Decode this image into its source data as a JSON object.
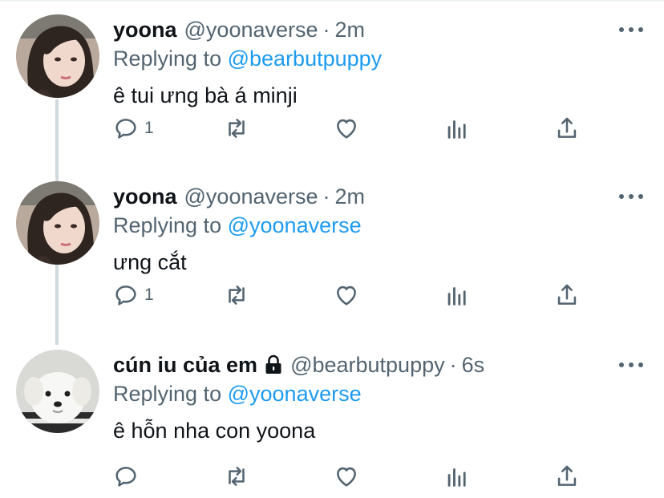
{
  "tweets": [
    {
      "name": "yoona",
      "handle": "@yoonaverse",
      "separator": "·",
      "time": "2m",
      "replying_prefix": "Replying to",
      "replying_to": "@bearbutpuppy",
      "text": "ê tui ưng bà á minji",
      "reply_count": "1",
      "avatar_icon": "girl-portrait-avatar",
      "protected": false
    },
    {
      "name": "yoona",
      "handle": "@yoonaverse",
      "separator": "·",
      "time": "2m",
      "replying_prefix": "Replying to",
      "replying_to": "@yoonaverse",
      "text": "ưng cắt",
      "reply_count": "1",
      "avatar_icon": "girl-portrait-avatar",
      "protected": false
    },
    {
      "name": "cún iu của em",
      "handle": "@bearbutpuppy",
      "separator": "·",
      "time": "6s",
      "replying_prefix": "Replying to",
      "replying_to": "@yoonaverse",
      "text": "ê hỗn nha con yoona",
      "reply_count": "",
      "avatar_icon": "white-puppy-avatar",
      "protected": true
    }
  ],
  "colors": {
    "text_primary": "#0f1419",
    "text_secondary": "#536471",
    "accent": "#1d9bf0",
    "thread_line": "#cfd9de"
  },
  "icons": [
    "reply-icon",
    "retweet-icon",
    "like-icon",
    "analytics-icon",
    "share-icon",
    "more-icon",
    "lock-icon"
  ]
}
